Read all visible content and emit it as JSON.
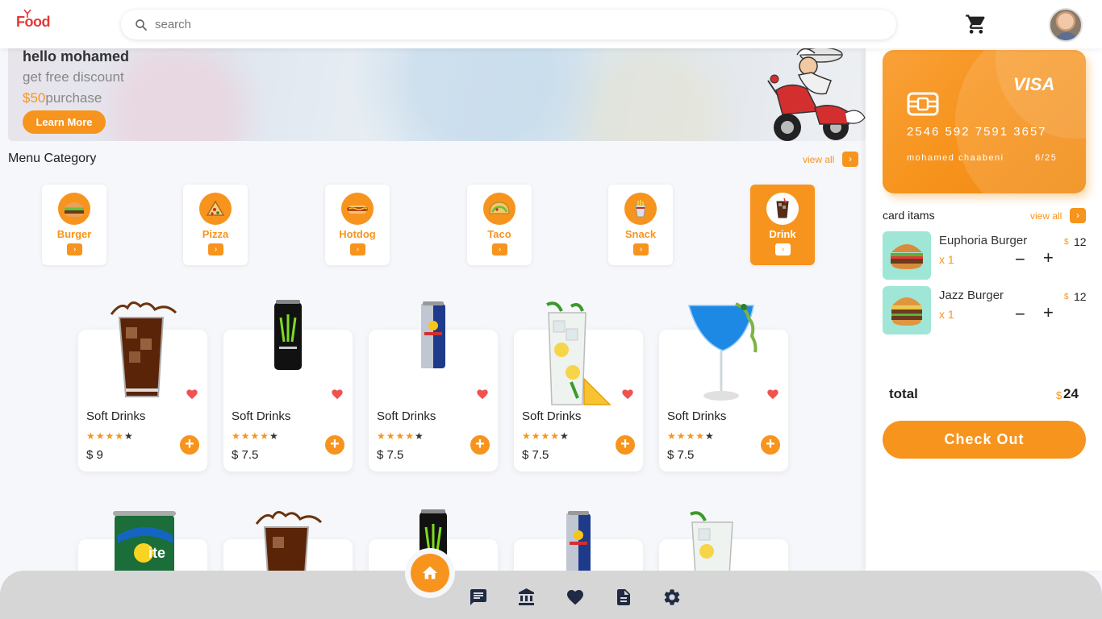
{
  "header": {
    "logo_text": "Food",
    "search_placeholder": "search"
  },
  "banner": {
    "greeting": "hello mohamed",
    "subtitle": "get free discount",
    "price": "$50",
    "price_suffix": "purchase",
    "button": "Learn More"
  },
  "menu": {
    "title": "Menu Category",
    "view_all": "view all",
    "categories": [
      {
        "label": "Burger",
        "icon": "burger-icon"
      },
      {
        "label": "Pizza",
        "icon": "pizza-icon"
      },
      {
        "label": "Hotdog",
        "icon": "hotdog-icon"
      },
      {
        "label": "Taco",
        "icon": "taco-icon"
      },
      {
        "label": "Snack",
        "icon": "snack-icon"
      },
      {
        "label": "Drink",
        "icon": "drink-icon",
        "active": true
      }
    ]
  },
  "products": [
    {
      "title": "Soft Drinks",
      "price": "$ 9",
      "rating": 4,
      "image": "cola-glass"
    },
    {
      "title": "Soft Drinks",
      "price": "$ 7.5",
      "rating": 4,
      "image": "monster-can"
    },
    {
      "title": "Soft Drinks",
      "price": "$ 7.5",
      "rating": 4,
      "image": "redbull-can"
    },
    {
      "title": "Soft Drinks",
      "price": "$ 7.5",
      "rating": 4,
      "image": "lemonade-glass"
    },
    {
      "title": "Soft Drinks",
      "price": "$ 7.5",
      "rating": 4,
      "image": "blue-cocktail"
    }
  ],
  "products_row2": [
    {
      "image": "sprite-can"
    },
    {
      "image": "cola-glass"
    },
    {
      "image": "monster-can"
    },
    {
      "image": "redbull-can"
    },
    {
      "image": "lemonade-glass"
    }
  ],
  "card": {
    "brand": "VISA",
    "number": "2546 592 7591 3657",
    "holder": "mohamed chaabeni",
    "expiry": "6/25"
  },
  "cart": {
    "title": "card itams",
    "view_all": "view all",
    "items": [
      {
        "name": "Euphoria Burger",
        "qty": "x 1",
        "currency": "$",
        "price": "12"
      },
      {
        "name": "Jazz Burger",
        "qty": "x 1",
        "currency": "$",
        "price": "12"
      }
    ],
    "total_label": "total",
    "total_currency": "$",
    "total_value": "24",
    "checkout": "Check Out"
  },
  "bottom_nav": {
    "items": [
      "home-icon",
      "chat-icon",
      "bank-icon",
      "heart-icon",
      "document-icon",
      "settings-icon"
    ]
  },
  "colors": {
    "accent": "#f7941d",
    "heart": "#ef5350",
    "cart_thumb_bg": "#9fe6d6"
  }
}
